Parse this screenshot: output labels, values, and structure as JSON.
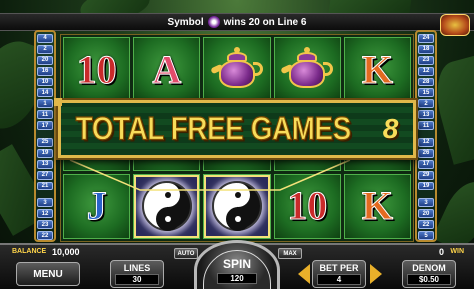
{
  "message": {
    "prefix": "Symbol",
    "suffix": "wins 20 on Line 6",
    "symbol_icon": "yin-yang-icon"
  },
  "line_numbers": {
    "left": [
      "4",
      "2",
      "20",
      "16",
      "10",
      "14",
      "1",
      "11",
      "17",
      "25",
      "19",
      "13",
      "27",
      "21",
      "3",
      "12",
      "23",
      "22"
    ],
    "right": [
      "24",
      "18",
      "23",
      "12",
      "28",
      "15",
      "2",
      "13",
      "11",
      "12",
      "26",
      "17",
      "29",
      "19",
      "3",
      "20",
      "22",
      "5"
    ]
  },
  "reels": [
    [
      "10",
      "A",
      "teapot",
      "teapot",
      "K"
    ],
    [
      "",
      "",
      "",
      "",
      ""
    ],
    [
      "J",
      "yin-yang",
      "yin-yang",
      "10",
      "K"
    ]
  ],
  "banner": {
    "text": "TOTAL FREE GAMES",
    "count": "8"
  },
  "balance": {
    "label": "BALANCE",
    "value": "10,000"
  },
  "win": {
    "label": "WIN",
    "value": "0"
  },
  "buttons": {
    "menu": "MENU",
    "lines_label": "LINES",
    "lines_value": "30",
    "auto": "AUTO",
    "spin": "SPIN",
    "spin_value": "120",
    "max": "MAX",
    "bet_per_label": "BET PER",
    "bet_per_value": "4",
    "denom_label": "DENOM",
    "denom_value": "$0.50"
  },
  "colors": {
    "gold": "#e0b84a",
    "reel_green": "#1d6c22",
    "line_blue": "#2a63c9"
  }
}
